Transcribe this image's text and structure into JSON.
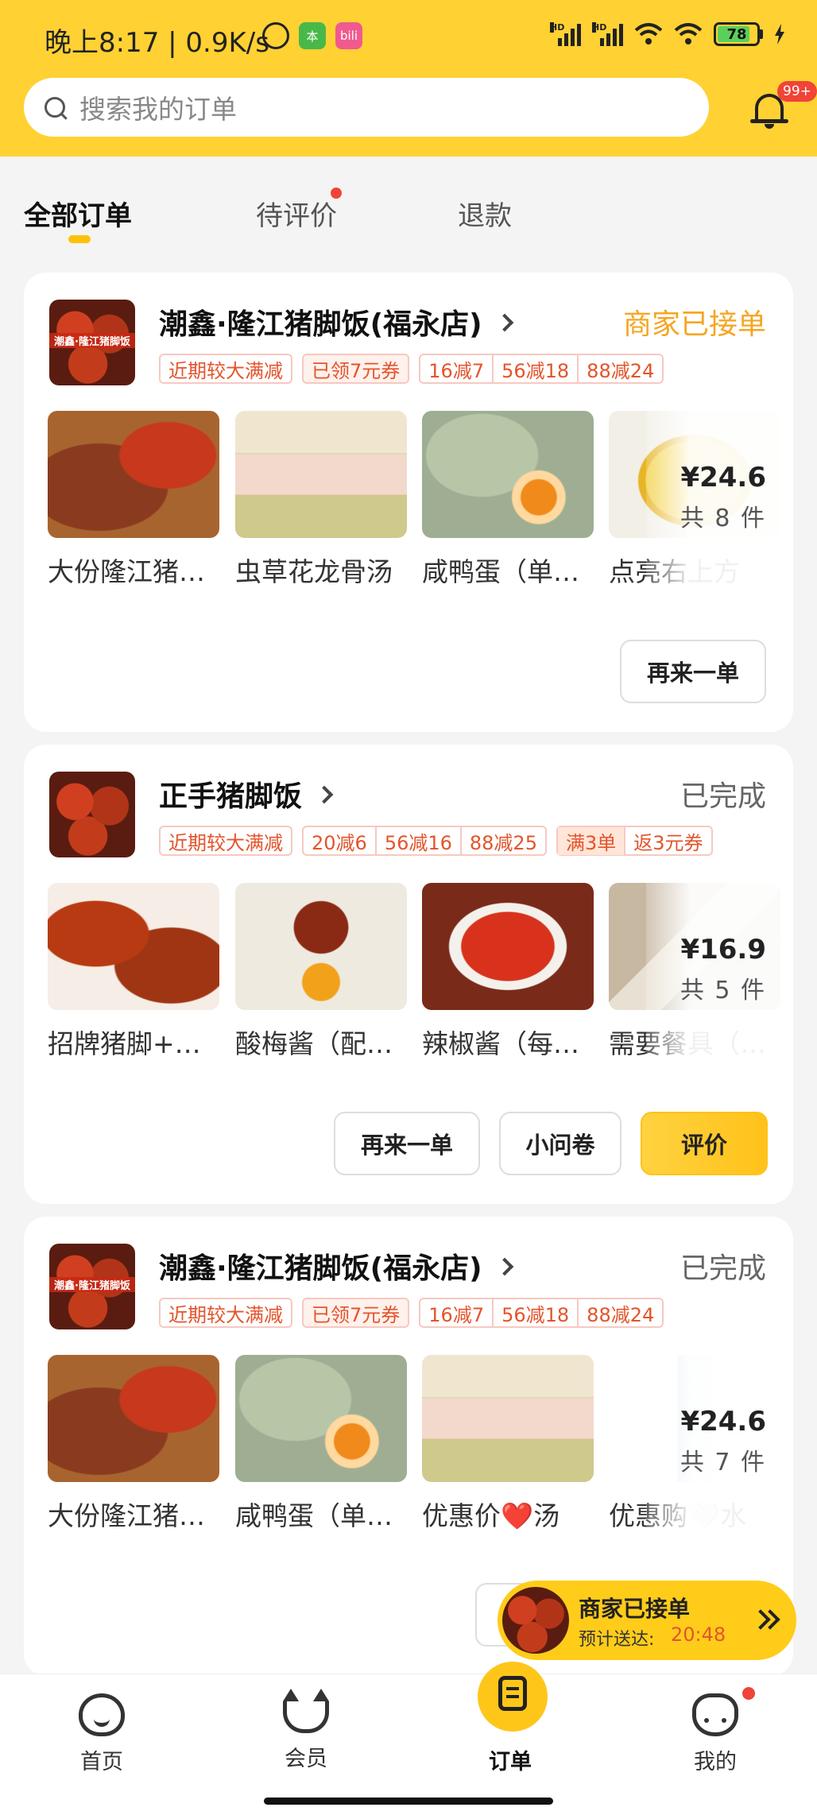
{
  "status_bar": {
    "time": "晚上8:17 | 0.9K/s",
    "app_badges": [
      {
        "text": "本",
        "color": "#49b84a"
      },
      {
        "text": "bili",
        "color": "#f05a8f"
      }
    ],
    "hd_label": "HD",
    "battery": "78"
  },
  "search": {
    "placeholder": "搜索我的订单"
  },
  "notifications": {
    "badge": "99+"
  },
  "tabs": [
    {
      "label": "全部订单",
      "active": true
    },
    {
      "label": "待评价",
      "dot": true
    },
    {
      "label": "退款"
    }
  ],
  "orders": [
    {
      "shop_name": "潮鑫·隆江猪脚饭(福永店)",
      "thumb_label": "潮鑫·隆江猪脚饭",
      "status": "商家已接单",
      "tags": [
        {
          "parts": [
            "近期较大满减"
          ]
        },
        {
          "parts": [
            "已领7元券"
          ],
          "fill": true
        },
        {
          "parts": [
            "16减7",
            "56减18",
            "88减24"
          ]
        }
      ],
      "items": [
        "大份隆江猪脚饭",
        "虫草花龙骨汤",
        "咸鸭蛋（单个）",
        "点亮右上方"
      ],
      "price": "¥24.6",
      "count": "共 8 件",
      "buttons": [
        "再来一单"
      ]
    },
    {
      "shop_name": "正手猪脚饭",
      "status": "已完成",
      "tags": [
        {
          "parts": [
            "近期较大满减"
          ]
        },
        {
          "parts": [
            "20减6",
            "56减16",
            "88减25"
          ]
        },
        {
          "parts": [
            "满3单",
            "返3元券"
          ],
          "fill": true
        }
      ],
      "items": [
        "招牌猪脚+烧鸭饭",
        "酸梅酱（配烧鸭）",
        "辣椒酱（每份）",
        "需要餐具（双）"
      ],
      "price": "¥16.9",
      "count": "共 5 件",
      "buttons": [
        "再来一单",
        "小问卷",
        "评价"
      ]
    },
    {
      "shop_name": "潮鑫·隆江猪脚饭(福永店)",
      "thumb_label": "潮鑫·隆江猪脚饭",
      "status": "已完成",
      "tags": [
        {
          "parts": [
            "近期较大满减"
          ]
        },
        {
          "parts": [
            "已领7元券"
          ],
          "fill": true
        },
        {
          "parts": [
            "16减7",
            "56减18",
            "88减24"
          ]
        }
      ],
      "items": [
        "大份隆江猪脚饭",
        "咸鸭蛋（单个）",
        "优惠价❤️汤",
        "优惠购🤍水"
      ],
      "price": "¥24.6",
      "count": "共 7 件"
    }
  ],
  "floating_banner": {
    "title": "商家已接单",
    "eta_label": "预计送达:",
    "eta_time": "20:48"
  },
  "bottom_nav": [
    {
      "label": "首页",
      "icon": "home-icon"
    },
    {
      "label": "会员",
      "icon": "member-icon"
    },
    {
      "label": "订单",
      "icon": "order-icon",
      "active": true
    },
    {
      "label": "我的",
      "icon": "mine-icon"
    }
  ],
  "colors": {
    "brand_yellow": "#ffd133",
    "accent_orange": "#f5a623",
    "tag_red": "#e4542c",
    "badge_red": "#f04438"
  }
}
